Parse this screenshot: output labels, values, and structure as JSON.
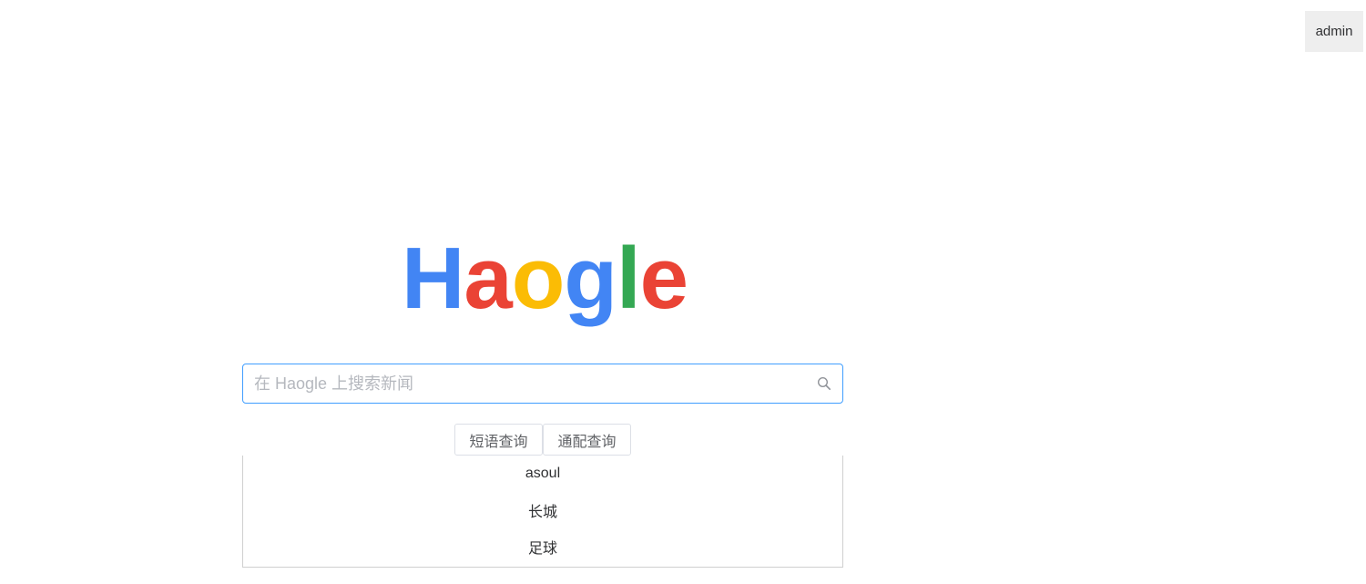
{
  "header": {
    "user_label": "admin"
  },
  "logo": {
    "letters": [
      {
        "char": "H",
        "color": "#4285F4"
      },
      {
        "char": "a",
        "color": "#EA4335"
      },
      {
        "char": "o",
        "color": "#FBBC05"
      },
      {
        "char": "g",
        "color": "#4285F4"
      },
      {
        "char": "l",
        "color": "#34A853"
      },
      {
        "char": "e",
        "color": "#EA4335"
      }
    ]
  },
  "search": {
    "placeholder": "在 Haogle 上搜索新闻",
    "value": "",
    "icon": "search-icon"
  },
  "buttons": {
    "phrase_label": "短语查询",
    "wildcard_label": "通配查询"
  },
  "suggestions": [
    "asoul",
    "长城",
    "足球"
  ],
  "colors": {
    "accent": "#409EFF",
    "button_bg": "#EEEEEE"
  }
}
